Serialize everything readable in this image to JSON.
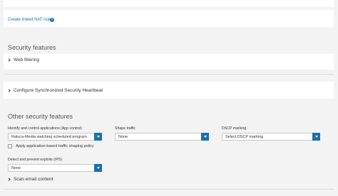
{
  "nat": {
    "create_link": "Create linked NAT rule",
    "info_icon": "i"
  },
  "security_features": {
    "title": "Security features",
    "web_filtering": "Web filtering",
    "heartbeat": "Configure Synchronized Security Heartbeat"
  },
  "other": {
    "title": "Other security features",
    "app_control_label": "Identify and control applications (App control)",
    "app_control_value": "Raluca-Media watching scheduled program",
    "shape_traffic_label": "Shape traffic",
    "shape_traffic_value": "None",
    "dscp_label": "DSCP marking",
    "dscp_value": "Select DSCP marking",
    "apply_shaping_label": "Apply application-based traffic shaping policy",
    "ips_label": "Detect and prevent exploits (IPS)",
    "ips_value": "None",
    "scan_email": "Scan email content"
  },
  "colors": {
    "accent": "#1a6fb0",
    "background": "#f3f3f3"
  }
}
